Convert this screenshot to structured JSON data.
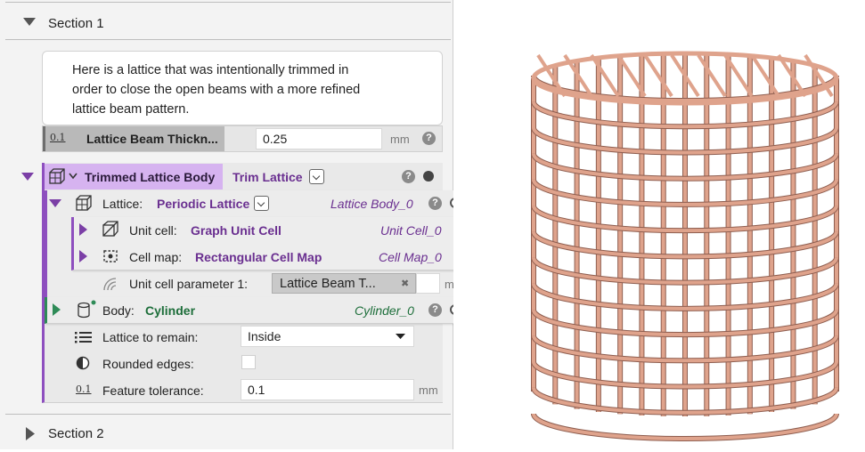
{
  "section1": {
    "label": "Section 1",
    "expanded": true
  },
  "note": {
    "text": "Here is a lattice that was intentionally trimmed in\norder to close the open beams with a more refined\nlattice beam pattern."
  },
  "beam_thickness": {
    "label": "Lattice Beam Thickn...",
    "value": "0.25",
    "unit": "mm",
    "icon_text": "0.1"
  },
  "trimmed_lattice_body": {
    "label": "Trimmed Lattice Body",
    "operation": "Trim Lattice",
    "lattice": {
      "label": "Lattice:",
      "value": "Periodic Lattice",
      "ref": "Lattice Body_0"
    },
    "unit_cell": {
      "label": "Unit cell:",
      "value": "Graph Unit Cell",
      "ref": "Unit Cell_0"
    },
    "cell_map": {
      "label": "Cell map:",
      "value": "Rectangular Cell Map",
      "ref": "Cell Map_0"
    },
    "unit_cell_param": {
      "label": "Unit cell parameter 1:",
      "value": "Lattice Beam T...",
      "unit": "mm"
    },
    "body": {
      "label": "Body:",
      "value": "Cylinder",
      "ref": "Cylinder_0"
    },
    "lattice_to_remain": {
      "label": "Lattice to remain:",
      "value": "Inside"
    },
    "rounded_edges": {
      "label": "Rounded edges:",
      "checked": false
    },
    "feature_tolerance": {
      "label": "Feature tolerance:",
      "value": "0.1",
      "unit": "mm",
      "icon_text": "0.1"
    }
  },
  "section2": {
    "label": "Section 2",
    "expanded": false
  },
  "colors": {
    "accent_purple": "#6a2f90",
    "body_green": "#1d6e3a",
    "lattice_beam": "#dfa38c"
  },
  "help_glyph": "?",
  "clear_glyph": "✖"
}
